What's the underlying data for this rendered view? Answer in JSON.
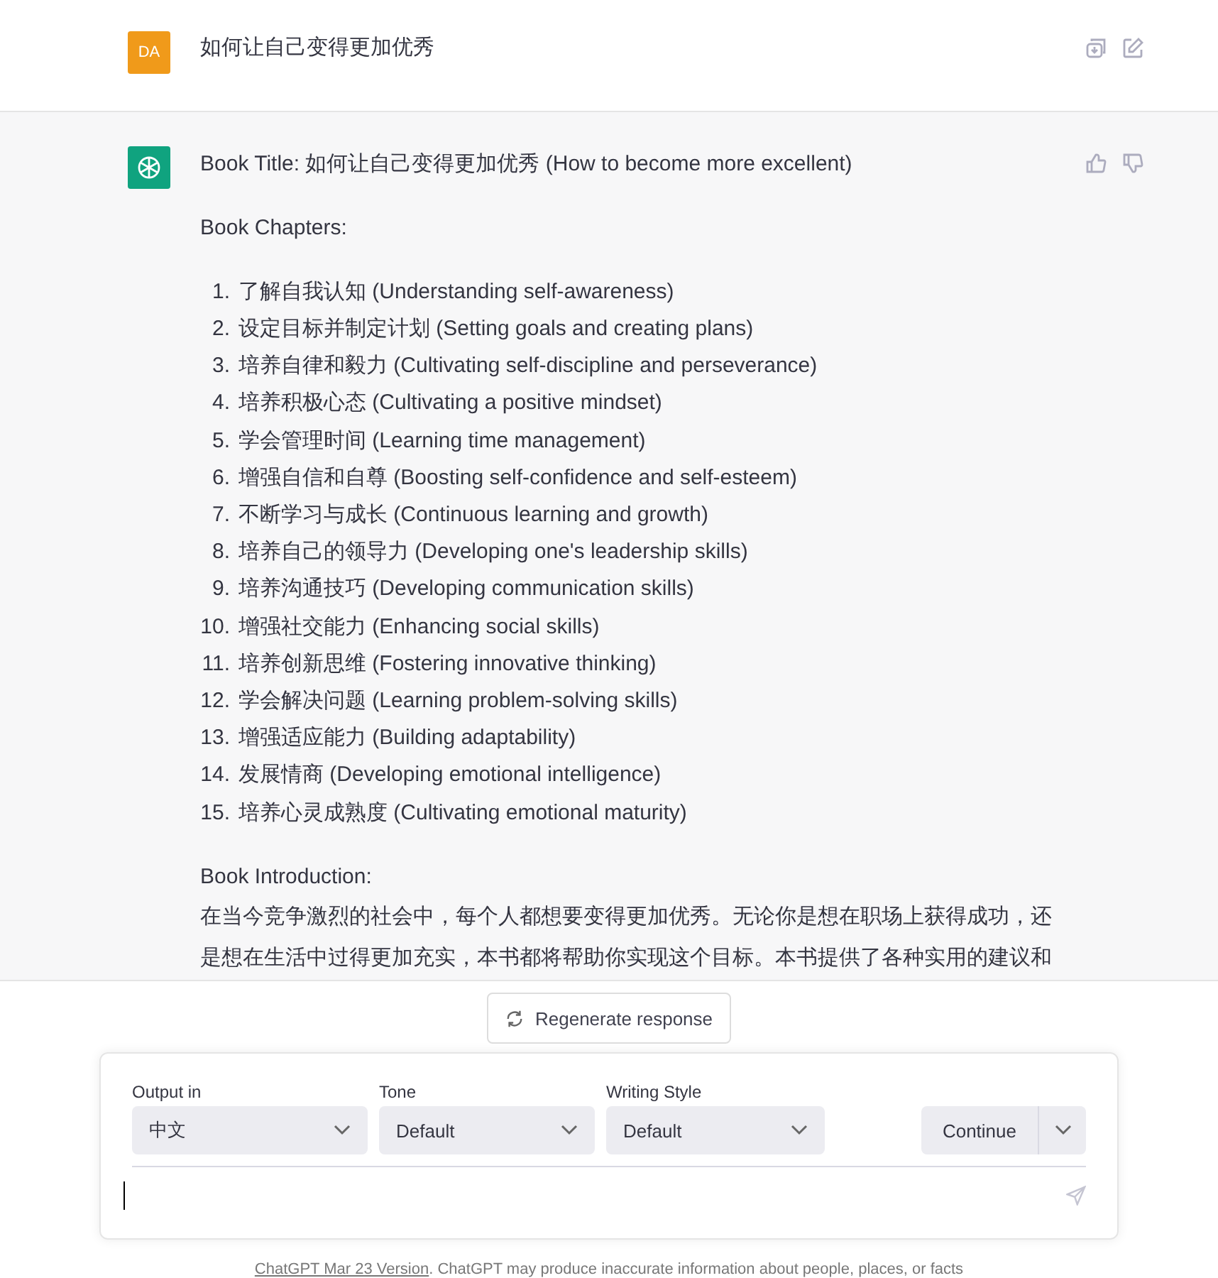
{
  "user_message": {
    "avatar": "DA",
    "text": "如何让自己变得更加优秀"
  },
  "assistant_message": {
    "title": "Book Title: 如何让自己变得更加优秀 (How to become more excellent)",
    "chapters_heading": "Book Chapters:",
    "chapters": [
      {
        "number": "1.",
        "text": "了解自我认知 (Understanding self-awareness)"
      },
      {
        "number": "2.",
        "text": "设定目标并制定计划 (Setting goals and creating plans)"
      },
      {
        "number": "3.",
        "text": "培养自律和毅力 (Cultivating self-discipline and perseverance)"
      },
      {
        "number": "4.",
        "text": "培养积极心态 (Cultivating a positive mindset)"
      },
      {
        "number": "5.",
        "text": "学会管理时间 (Learning time management)"
      },
      {
        "number": "6.",
        "text": "增强自信和自尊 (Boosting self-confidence and self-esteem)"
      },
      {
        "number": "7.",
        "text": "不断学习与成长 (Continuous learning and growth)"
      },
      {
        "number": "8.",
        "text": "培养自己的领导力 (Developing one's leadership skills)"
      },
      {
        "number": "9.",
        "text": "培养沟通技巧 (Developing communication skills)"
      },
      {
        "number": "10.",
        "text": "增强社交能力 (Enhancing social skills)"
      },
      {
        "number": "11.",
        "text": "培养创新思维 (Fostering innovative thinking)"
      },
      {
        "number": "12.",
        "text": "学会解决问题 (Learning problem-solving skills)"
      },
      {
        "number": "13.",
        "text": "增强适应能力 (Building adaptability)"
      },
      {
        "number": "14.",
        "text": "发展情商 (Developing emotional intelligence)"
      },
      {
        "number": "15.",
        "text": "培养心灵成熟度 (Cultivating emotional maturity)"
      }
    ],
    "intro_heading": "Book Introduction:",
    "intro_text": "在当今竞争激烈的社会中，每个人都想要变得更加优秀。无论你是想在职场上获得成功，还是想在生活中过得更加充实，本书都将帮助你实现这个目标。本书提供了各种实用的建议和"
  },
  "regenerate_button": "Regenerate response",
  "composer": {
    "dropdowns": [
      {
        "label": "Output in",
        "value": "中文"
      },
      {
        "label": "Tone",
        "value": "Default"
      },
      {
        "label": "Writing Style",
        "value": "Default"
      }
    ],
    "continue_button": "Continue"
  },
  "footer": {
    "link": "ChatGPT Mar 23 Version",
    "text": ". ChatGPT may produce inaccurate information about people, places, or facts"
  }
}
